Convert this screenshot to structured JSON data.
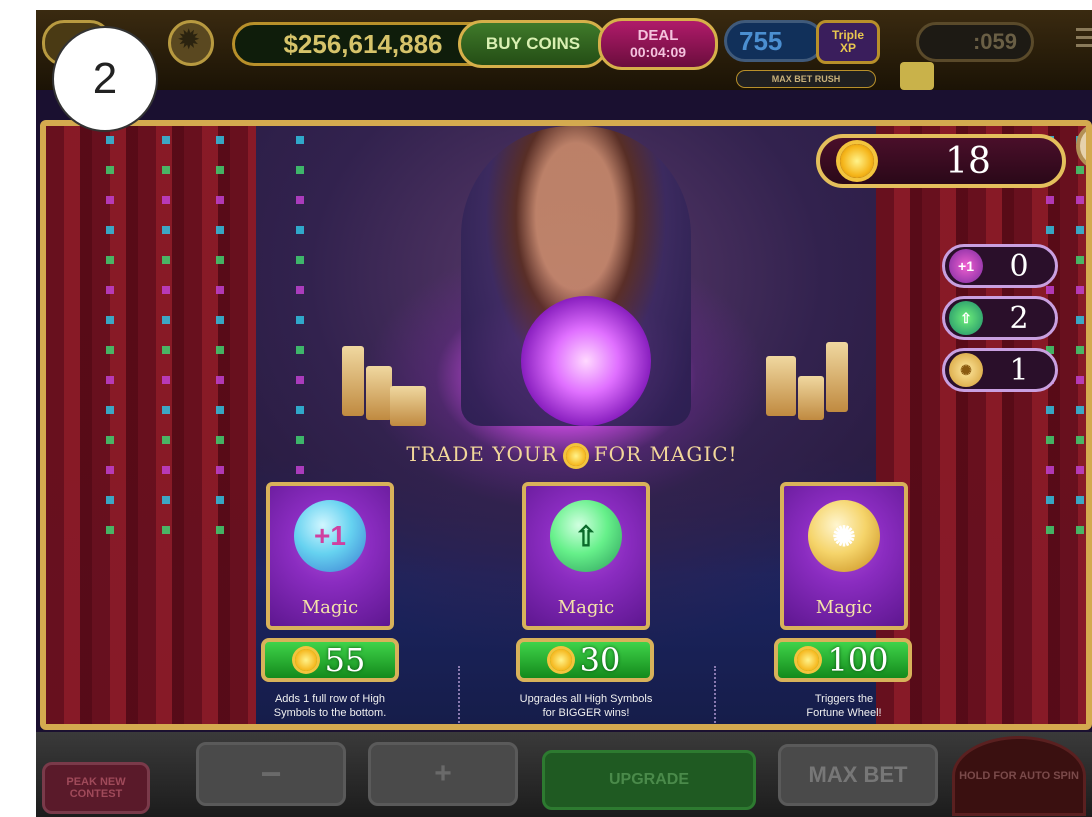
{
  "step_marker": "2",
  "topbar": {
    "coins": "$256,614,886",
    "buy_coins": "BUY COINS",
    "deal_label": "DEAL",
    "deal_timer": "00:04:09",
    "xp_value": "755",
    "xp_badge_top": "Triple",
    "xp_badge_bottom": "XP",
    "max_bet_rush": "MAX BET RUSH",
    "timer": ":059"
  },
  "popup": {
    "sun_balance": "18",
    "inventory": [
      {
        "icon": "plus-one-row-icon",
        "glyph": "+1",
        "count": "0"
      },
      {
        "icon": "upgrade-arrow-icon",
        "glyph": "⇧",
        "count": "2"
      },
      {
        "icon": "fortune-wheel-icon",
        "glyph": "✺",
        "count": "1"
      }
    ],
    "heading_left": "TRADE YOUR",
    "heading_right": "FOR MAGIC!",
    "close_glyph": "✕",
    "cards": [
      {
        "icon": "plus-one-row-icon",
        "glyph": "+1",
        "label": "Magic",
        "price": "55",
        "desc_line1": "Adds 1 full row of High",
        "desc_line2": "Symbols to the bottom."
      },
      {
        "icon": "upgrade-arrow-icon",
        "glyph": "⇧",
        "label": "Magic",
        "price": "30",
        "desc_line1": "Upgrades all High Symbols",
        "desc_line2": "for BIGGER wins!"
      },
      {
        "icon": "fortune-wheel-icon",
        "glyph": "✺",
        "label": "Magic",
        "price": "100",
        "desc_line1": "Triggers the",
        "desc_line2": "Fortune Wheel!"
      }
    ]
  },
  "bottombar": {
    "contest": "PEAK NEW CONTEST",
    "minus": "−",
    "plus": "+",
    "upgrade": "UPGRADE",
    "max_bet": "MAX BET",
    "hold_for_auto_spin": "HOLD FOR AUTO SPIN"
  },
  "colors": {
    "frame_gold": "#d4aa4f",
    "price_green": "#2fb83a",
    "card_purple": "#8a2cc0"
  }
}
